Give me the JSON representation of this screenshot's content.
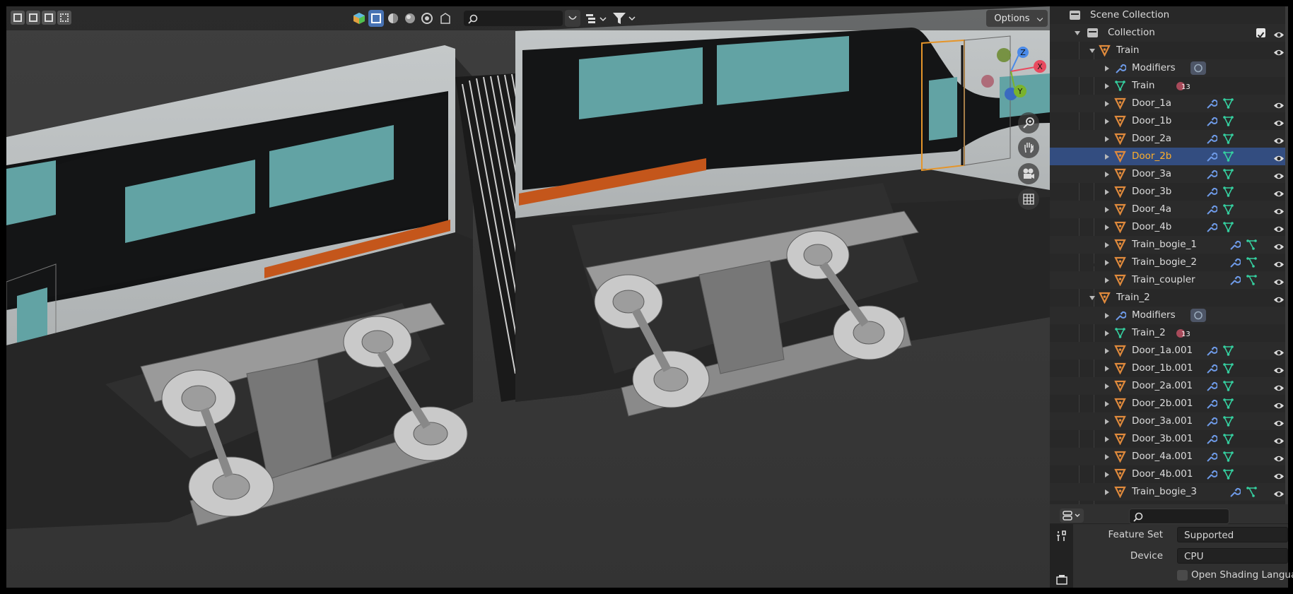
{
  "viewport": {
    "options_label": "Options",
    "search_placeholder": "",
    "colors": {
      "train_body": "#b7bbbc",
      "window": "#62a3a4",
      "stripe": "#c4561b",
      "bogie": "#9a9a9a",
      "floor": "#3a3a3a"
    }
  },
  "outliner": {
    "scene_collection": "Scene Collection",
    "collection": "Collection",
    "rows": [
      {
        "label": "Train",
        "type": "object",
        "level": 2,
        "open": true
      },
      {
        "label": "Modifiers",
        "type": "modifiers",
        "level": 3
      },
      {
        "label": "Train",
        "type": "mesh",
        "level": 3,
        "badge": "13"
      },
      {
        "label": "Door_1a",
        "type": "object",
        "level": 3
      },
      {
        "label": "Door_1b",
        "type": "object",
        "level": 3
      },
      {
        "label": "Door_2a",
        "type": "object",
        "level": 3
      },
      {
        "label": "Door_2b",
        "type": "object",
        "level": 3,
        "selected": true
      },
      {
        "label": "Door_3a",
        "type": "object",
        "level": 3
      },
      {
        "label": "Door_3b",
        "type": "object",
        "level": 3
      },
      {
        "label": "Door_4a",
        "type": "object",
        "level": 3
      },
      {
        "label": "Door_4b",
        "type": "object",
        "level": 3
      },
      {
        "label": "Train_bogie_1",
        "type": "object",
        "level": 3,
        "curve": true
      },
      {
        "label": "Train_bogie_2",
        "type": "object",
        "level": 3,
        "curve": true
      },
      {
        "label": "Train_coupler",
        "type": "object",
        "level": 3,
        "curve": true
      },
      {
        "label": "Train_2",
        "type": "object",
        "level": 2,
        "open": true
      },
      {
        "label": "Modifiers",
        "type": "modifiers",
        "level": 3
      },
      {
        "label": "Train_2",
        "type": "mesh",
        "level": 3,
        "badge": "13"
      },
      {
        "label": "Door_1a.001",
        "type": "object",
        "level": 3
      },
      {
        "label": "Door_1b.001",
        "type": "object",
        "level": 3
      },
      {
        "label": "Door_2a.001",
        "type": "object",
        "level": 3
      },
      {
        "label": "Door_2b.001",
        "type": "object",
        "level": 3
      },
      {
        "label": "Door_3a.001",
        "type": "object",
        "level": 3
      },
      {
        "label": "Door_3b.001",
        "type": "object",
        "level": 3
      },
      {
        "label": "Door_4a.001",
        "type": "object",
        "level": 3
      },
      {
        "label": "Door_4b.001",
        "type": "object",
        "level": 3
      },
      {
        "label": "Train_bogie_3",
        "type": "object",
        "level": 3,
        "curve": true
      }
    ]
  },
  "properties": {
    "search_placeholder": "",
    "feature_set_label": "Feature Set",
    "feature_set_value": "Supported",
    "device_label": "Device",
    "device_value": "CPU",
    "osl_label": "Open Shading Langua"
  },
  "gizmo": {
    "x": "X",
    "y": "Y",
    "z": "Z"
  }
}
